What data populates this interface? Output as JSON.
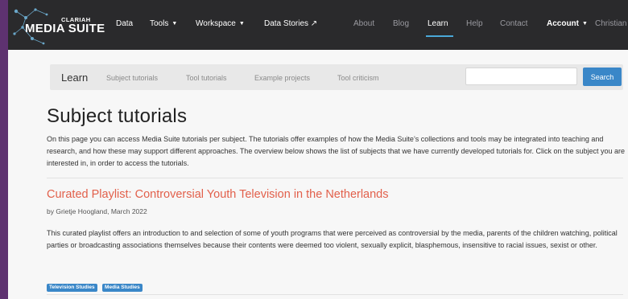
{
  "brand": {
    "small": "CLARIAH",
    "big": "MEDIA SUITE",
    "accent_color": "#4aa8d8"
  },
  "nav": {
    "items": [
      {
        "label": "Data",
        "caret": false,
        "dim": false,
        "active": false
      },
      {
        "label": "Tools",
        "caret": true,
        "dim": false,
        "active": false
      },
      {
        "label": "Workspace",
        "caret": true,
        "dim": false,
        "active": false
      },
      {
        "label": "Data Stories ↗",
        "caret": false,
        "dim": false,
        "active": false
      },
      {
        "label": "About",
        "caret": false,
        "dim": true,
        "active": false
      },
      {
        "label": "Blog",
        "caret": false,
        "dim": true,
        "active": false
      },
      {
        "label": "Learn",
        "caret": false,
        "dim": false,
        "active": true
      },
      {
        "label": "Help",
        "caret": false,
        "dim": true,
        "active": false
      },
      {
        "label": "Contact",
        "caret": false,
        "dim": true,
        "active": false
      },
      {
        "label": "Account",
        "caret": true,
        "dim": false,
        "active": false
      },
      {
        "label": "Christian",
        "caret": false,
        "dim": true,
        "active": false
      }
    ]
  },
  "subnav": {
    "title": "Learn",
    "links": [
      "Subject tutorials",
      "Tool tutorials",
      "Example projects",
      "Tool criticism"
    ],
    "search_value": "",
    "search_button": "Search"
  },
  "page": {
    "title": "Subject tutorials",
    "intro": "On this page you can access Media Suite tutorials per subject. The tutorials offer examples of how the Media Suite’s collections and tools may be integrated into teaching and research, and how these may support different approaches. The overview below shows the list of subjects that we have currently developed tutorials for. Click on the subject you are interested in, in order to access the tutorials."
  },
  "article": {
    "title": "Curated Playlist: Controversial Youth Television in the Netherlands",
    "byline": "by Grietje Hoogland, March 2022",
    "description": "This curated playlist offers an introduction to and selection of some of youth programs that were perceived as controversial by the media, parents of the children watching, political parties or broadcasting associations themselves because their contents were deemed too violent, sexually explicit, blasphemous, insensitive to racial issues, sexist or other.",
    "tags": [
      "Television Studies",
      "Media Studies"
    ],
    "title_color": "#e2604b",
    "tag_color": "#3a87c8"
  }
}
